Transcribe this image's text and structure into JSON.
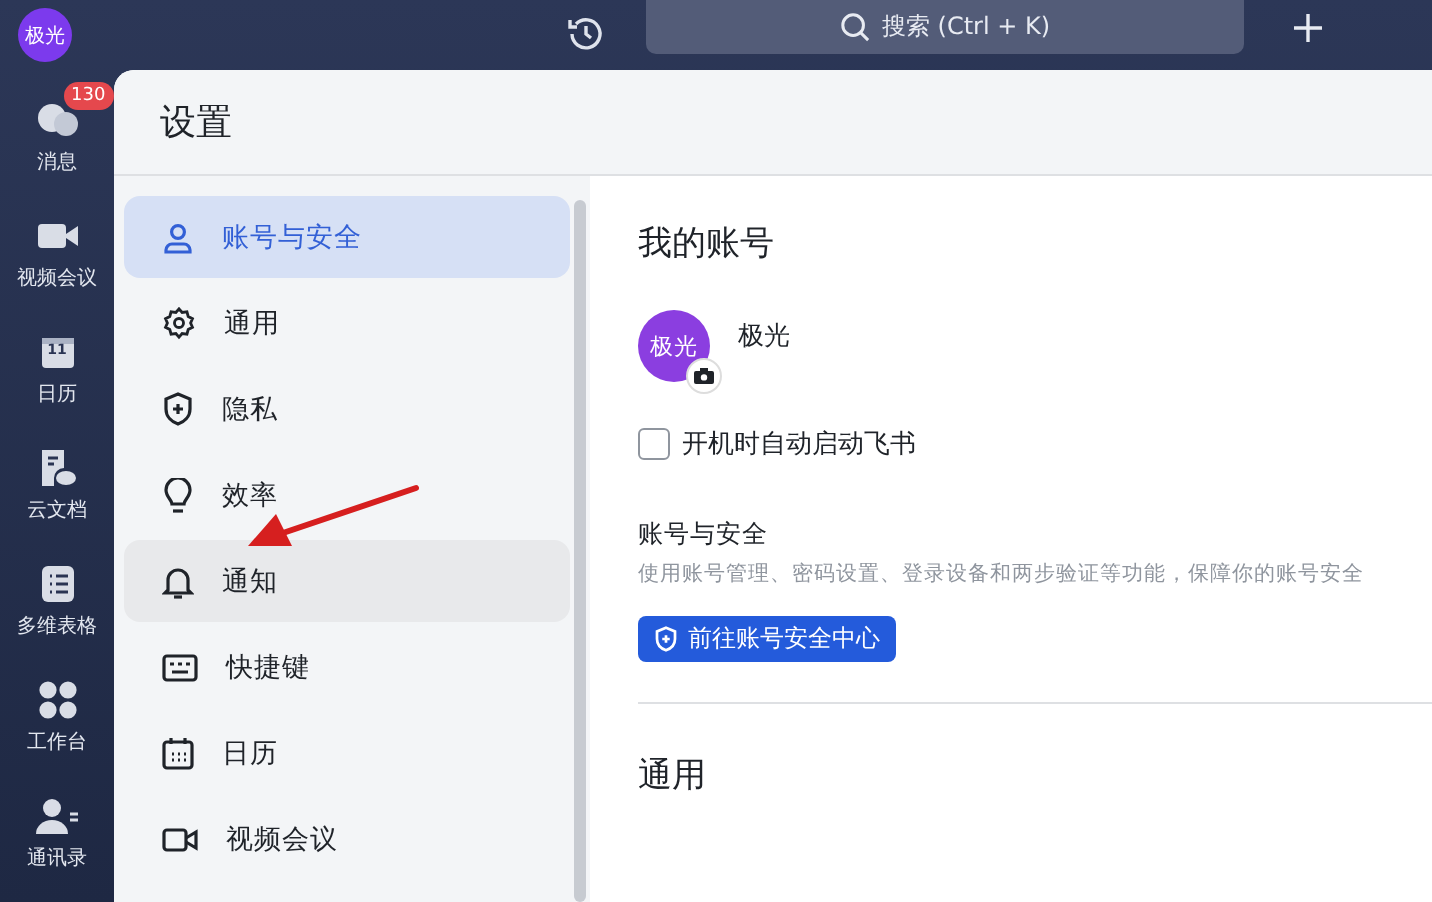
{
  "top_bar": {
    "avatar": "极光",
    "search": {
      "placeholder": "搜索 (Ctrl + K)"
    }
  },
  "rail": [
    {
      "kind": "chat",
      "label": "消息",
      "badge": "130"
    },
    {
      "kind": "video",
      "label": "视频会议"
    },
    {
      "kind": "calendar",
      "label": "日历",
      "icon_text": "11"
    },
    {
      "kind": "doc",
      "label": "云文档"
    },
    {
      "kind": "table",
      "label": "多维表格"
    },
    {
      "kind": "apps",
      "label": "工作台"
    },
    {
      "kind": "contacts",
      "label": "通讯录"
    }
  ],
  "settings": {
    "title": "设置",
    "menu": [
      {
        "kind": "user",
        "label": "账号与安全",
        "selected": true,
        "hovered": false
      },
      {
        "kind": "gear",
        "label": "通用",
        "selected": false,
        "hovered": false
      },
      {
        "kind": "shield",
        "label": "隐私",
        "selected": false,
        "hovered": false
      },
      {
        "kind": "bulb",
        "label": "效率",
        "selected": false,
        "hovered": false
      },
      {
        "kind": "bell",
        "label": "通知",
        "selected": false,
        "hovered": true
      },
      {
        "kind": "keyboard",
        "label": "快捷键",
        "selected": false,
        "hovered": false
      },
      {
        "kind": "calendar",
        "label": "日历",
        "selected": false,
        "hovered": false
      },
      {
        "kind": "video",
        "label": "视频会议",
        "selected": false,
        "hovered": false
      }
    ],
    "content": {
      "heading": "我的账号",
      "avatar": "极光",
      "name": "极光",
      "checkbox": {
        "label": "开机时自动启动飞书",
        "checked": false
      },
      "section_title": "账号与安全",
      "section_desc": "使用账号管理、密码设置、登录设备和两步验证等功能，保障你的账号安全",
      "button": "前往账号安全中心",
      "next_heading": "通用"
    }
  }
}
